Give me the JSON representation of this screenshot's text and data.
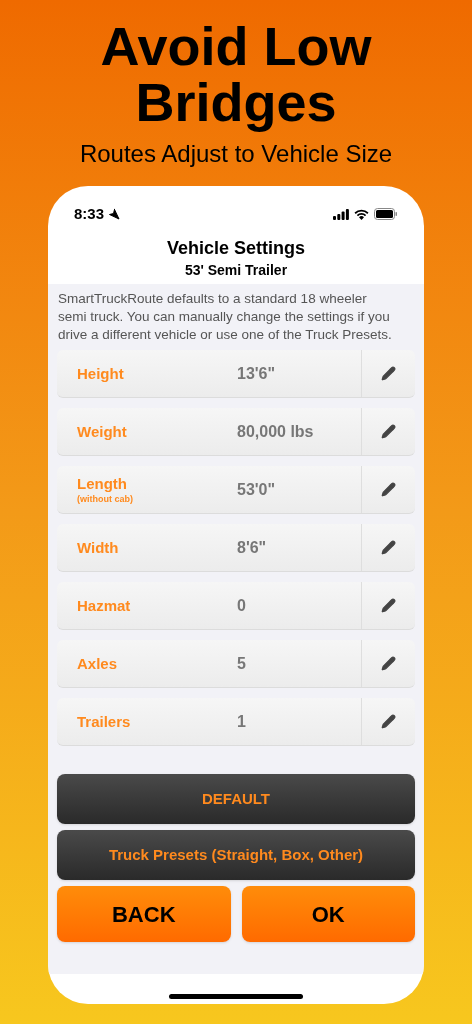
{
  "headline": "Avoid Low Bridges",
  "subheadline": "Routes Adjust to Vehicle Size",
  "status_bar": {
    "time": "8:33"
  },
  "nav": {
    "title": "Vehicle Settings",
    "subtitle": "53' Semi Trailer"
  },
  "description": "SmartTruckRoute defaults to a standard 18 wheeler semi truck. You can manually change the settings if you drive a different vehicle or use one of the Truck Presets.",
  "settings": [
    {
      "label": "Height",
      "value": "13'6\""
    },
    {
      "label": "Weight",
      "value": "80,000 lbs"
    },
    {
      "label": "Length",
      "note": "(without cab)",
      "value": "53'0\""
    },
    {
      "label": "Width",
      "value": "8'6\""
    },
    {
      "label": "Hazmat",
      "value": "0"
    },
    {
      "label": "Axles",
      "value": "5"
    },
    {
      "label": "Trailers",
      "value": "1"
    }
  ],
  "buttons": [
    {
      "label": "DEFAULT",
      "kind": "dark"
    },
    {
      "label": "Truck Presets (Straight, Box, Other)",
      "kind": "dark"
    },
    {
      "label": "BACK",
      "kind": "orange"
    },
    {
      "label": "OK",
      "kind": "orange"
    }
  ]
}
